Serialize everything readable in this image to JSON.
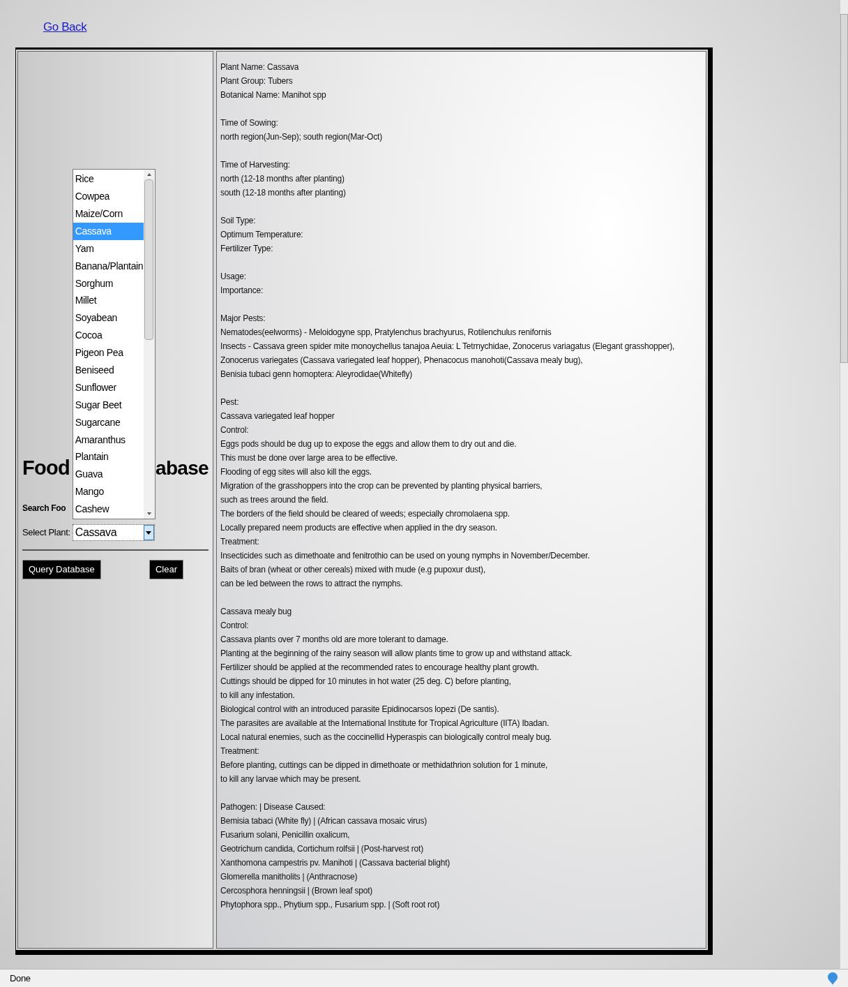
{
  "link": {
    "label": "Go Back"
  },
  "search_panel": {
    "title_left": "Food",
    "title_right": "abase",
    "subtitle": "Search Foo",
    "select": {
      "label": "Select Plant:",
      "value": "Cassava",
      "expanded": true
    },
    "options": [
      {
        "label": "Rice",
        "selected": false
      },
      {
        "label": "Cowpea",
        "selected": false
      },
      {
        "label": "Maize/Corn",
        "selected": false
      },
      {
        "label": "Cassava",
        "selected": true
      },
      {
        "label": "Yam",
        "selected": false
      },
      {
        "label": "Banana/Plantain",
        "selected": false
      },
      {
        "label": "Sorghum",
        "selected": false
      },
      {
        "label": "Millet",
        "selected": false
      },
      {
        "label": "Soyabean",
        "selected": false
      },
      {
        "label": "Cocoa",
        "selected": false
      },
      {
        "label": "Pigeon Pea",
        "selected": false
      },
      {
        "label": "Beniseed",
        "selected": false
      },
      {
        "label": "Sunflower",
        "selected": false
      },
      {
        "label": "Sugar Beet",
        "selected": false
      },
      {
        "label": "Sugarcane",
        "selected": false
      },
      {
        "label": "Amaranthus",
        "selected": false
      },
      {
        "label": "Plantain",
        "selected": false
      },
      {
        "label": "Guava",
        "selected": false
      },
      {
        "label": "Mango",
        "selected": false
      },
      {
        "label": "Cashew",
        "selected": false
      }
    ],
    "buttons": [
      "Query Database",
      "Clear"
    ]
  },
  "details": {
    "blocks": [
      [
        "Plant Name: Cassava",
        "Plant Group: Tubers",
        "Botanical Name: Manihot spp"
      ],
      [
        "Time of Sowing:",
        "north region(Jun-Sep); south region(Mar-Oct)"
      ],
      [
        "Time of Harvesting:",
        "north (12-18 months after planting)",
        "south (12-18 months after planting)"
      ],
      [
        "Soil Type:",
        "Optimum Temperature:",
        "Fertilizer Type:"
      ],
      [
        "Usage:",
        "Importance:"
      ],
      [
        "Major Pests:",
        "Nematodes(eelworms) - Meloidogyne spp, Pratylenchus brachyurus, Rotilenchulus renifornis",
        "Insects - Cassava green spider mite monoychellus tanajoa Aeuia: L Tetrnychidae, Zonocerus variagatus (Elegant grasshopper),",
        "Zonocerus variegates (Cassava variegated leaf hopper), Phenacocus manohoti(Cassava mealy bug),",
        "Benisia tubaci genn homoptera: Aleyrodidae(Whitefly)"
      ],
      [
        "Pest:",
        "Cassava variegated leaf hopper",
        "Control:",
        "Eggs pods should be dug up to expose the eggs and allow them to dry out and die.",
        "This must be done over large area to be effective.",
        "Flooding of egg sites will also kill the eggs.",
        "Migration of the grasshoppers into the crop can be prevented by planting physical barriers,",
        "such as trees around the field.",
        "The borders of the field should be cleared of weeds; especially chromolaena spp.",
        "Locally prepared neem products are effective when applied in the dry season.",
        "Treatment:",
        "Insecticides such as dimethoate and fenitrothio can be used on young nymphs in November/December.",
        "Baits of bran (wheat or other cereals) mixed with mude (e.g pupoxur dust),",
        "can be led between the rows to attract the nymphs."
      ],
      [
        "Cassava mealy bug",
        "Control:",
        "Cassava plants over 7 months old are more tolerant to damage.",
        "Planting at the beginning of the rainy season will allow plants time to grow up and withstand attack.",
        "Fertilizer should be applied at the recommended rates to encourage healthy plant growth.",
        "Cuttings should be dipped for 10 minutes in hot water (25 deg. C) before planting,",
        "to kill any infestation.",
        "Biological control with an introduced parasite Epidinocarsos lopezi (De santis).",
        "The parasites are available at the International Institute for Tropical Agriculture (IITA) Ibadan.",
        "Local natural enemies, such as the coccinellid Hyperaspis can biologically control mealy bug.",
        "Treatment:",
        "Before planting, cuttings can be dipped in dimethoate or methidathrion solution for 1 minute,",
        "to kill any larvae which may be present."
      ],
      [
        "Pathogen: | Disease Caused:",
        "Bemisia tabaci (White fly) | (African cassava mosaic virus)",
        "Fusarium solani, Penicillin oxalicum,",
        "Geotrichum candida, Cortichum rolfsii | (Post-harvest rot)",
        "Xanthomona campestris pv. Manihoti | (Cassava bacterial blight)",
        "Glomerella manitholits | (Anthracnose)",
        "Cercosphora henningsii | (Brown leaf spot)",
        "Phytophora spp., Phytium spp., Fusarium spp. | (Soft root rot)"
      ]
    ]
  },
  "status_bar": {
    "text": "Done"
  }
}
